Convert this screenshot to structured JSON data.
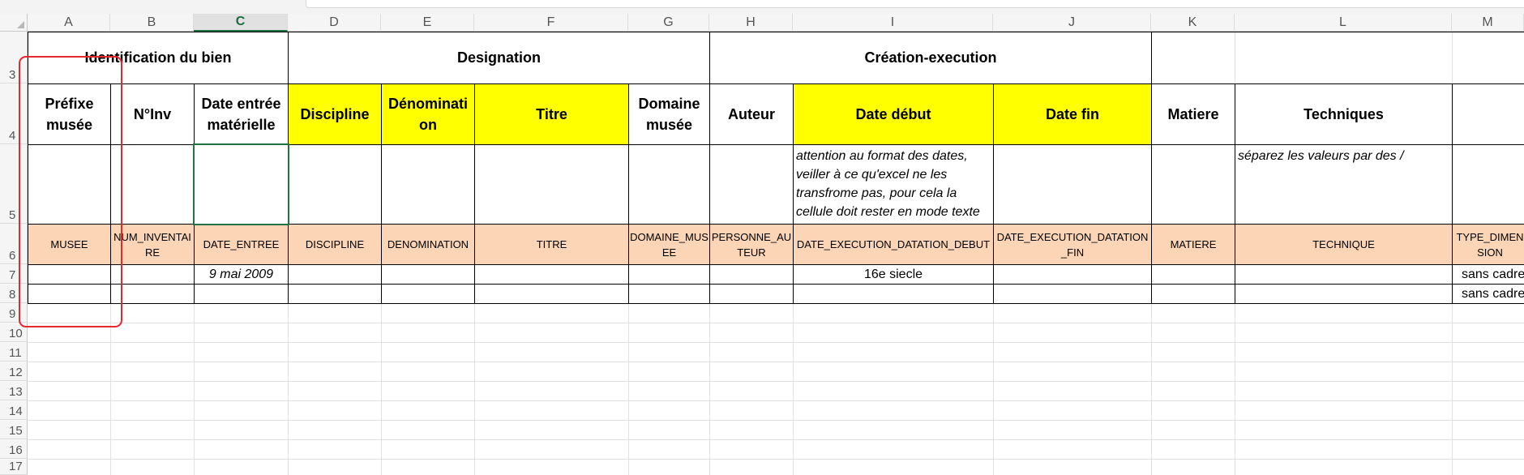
{
  "columns": [
    "A",
    "B",
    "C",
    "D",
    "E",
    "F",
    "G",
    "H",
    "I",
    "J",
    "K",
    "L",
    "M"
  ],
  "rows": [
    "3",
    "4",
    "5",
    "6",
    "7",
    "8",
    "9",
    "10",
    "11",
    "12",
    "13",
    "14",
    "15",
    "16",
    "17"
  ],
  "row3": {
    "identification": "Identification du bien",
    "designation": "Designation",
    "creation": "Création-execution"
  },
  "row4": {
    "A": "Préfixe musée",
    "B": "N°Inv",
    "C": "Date entrée matérielle",
    "D": "Discipline",
    "E": "Dénomination",
    "F": "Titre",
    "G": "Domaine musée",
    "H": "Auteur",
    "I": "Date début",
    "J": "Date fin",
    "K": "Matiere",
    "L": "Techniques"
  },
  "row5": {
    "I": "attention au format des dates, veiller à ce qu'excel ne les transfrome pas, pour cela la cellule doit rester en mode texte",
    "L": "séparez les valeurs par des /"
  },
  "row6": {
    "A": "MUSEE",
    "B": "NUM_INVENTAIRE",
    "C": "DATE_ENTREE",
    "D": "DISCIPLINE",
    "E": "DENOMINATION",
    "F": "TITRE",
    "G": "DOMAINE_MUSEE",
    "H": "PERSONNE_AUTEUR",
    "I": "DATE_EXECUTION_DATATION_DEBUT",
    "J": "DATE_EXECUTION_DATATION_FIN",
    "K": "MATIERE",
    "L": "TECHNIQUE",
    "M": "TYPE_DIMENSION"
  },
  "row7": {
    "C": "9 mai 2009",
    "I": "16e siecle",
    "M": "sans cadre"
  },
  "row8": {
    "M": "sans cadre"
  },
  "colors": {
    "highlight_yellow": "#ffff00",
    "code_row": "#fbd5b5",
    "selection_green": "#217346",
    "annotation_red": "#e8262e"
  }
}
